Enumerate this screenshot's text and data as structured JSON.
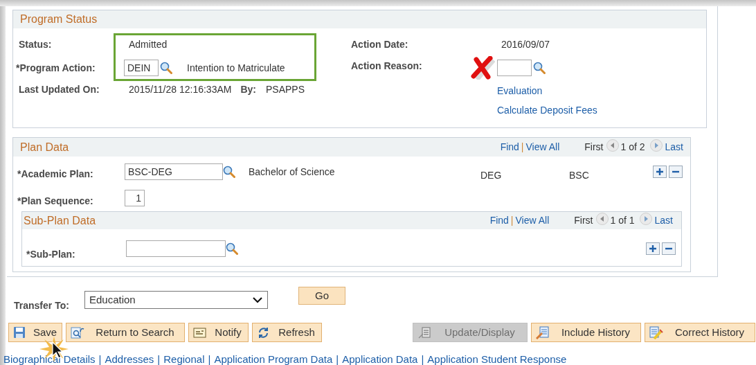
{
  "program_status": {
    "title": "Program Status",
    "status": {
      "label": "Status:",
      "value": "Admitted"
    },
    "program_action": {
      "label": "*Program Action:",
      "value": "DEIN",
      "description": "Intention to Matriculate"
    },
    "last_updated": {
      "label": "Last Updated On:",
      "value": "2015/11/28 12:16:33AM",
      "by_label": "By:",
      "by_value": "PSAPPS"
    },
    "action_date": {
      "label": "Action Date:",
      "value": "2016/09/07"
    },
    "action_reason": {
      "label": "Action Reason:"
    },
    "links": [
      "Evaluation",
      "Calculate Deposit Fees"
    ]
  },
  "plan_data": {
    "title": "Plan Data",
    "nav": {
      "find": "Find",
      "separator": "|",
      "view_all": "View All",
      "first": "First",
      "count": "1 of 2",
      "last": "Last"
    },
    "academic_plan": {
      "label": "*Academic Plan:",
      "value": "BSC-DEG",
      "description": "Bachelor of Science",
      "column_4": "DEG",
      "column_5": "BSC"
    },
    "plan_sequence": {
      "label": "*Plan Sequence:",
      "value": "1"
    },
    "sub_plan_data": {
      "title": "Sub-Plan Data",
      "nav": {
        "find": "Find",
        "separator": "|",
        "view_all": "View All",
        "first": "First",
        "count": "1 of 1",
        "last": "Last"
      },
      "sub_plan": {
        "label": "*Sub-Plan:"
      }
    }
  },
  "transfer": {
    "label": "Transfer To:",
    "value": "Education",
    "go": "Go"
  },
  "buttons": [
    {
      "label": "Save",
      "kind": "save",
      "disabled": false
    },
    {
      "label": "Return to Search",
      "kind": "return",
      "disabled": false
    },
    {
      "label": "Notify",
      "kind": "notify",
      "disabled": false
    },
    {
      "label": "Refresh",
      "kind": "refresh",
      "disabled": false
    },
    {
      "label": "Update/Display",
      "kind": "update",
      "disabled": true
    },
    {
      "label": "Include History",
      "kind": "include",
      "disabled": false
    },
    {
      "label": "Correct History",
      "kind": "correct",
      "disabled": false
    }
  ],
  "links": {
    "separator": "|",
    "items": [
      "Biographical Details",
      "Addresses",
      "Regional",
      "Application Program Data",
      "Application Data",
      "Application Student Response"
    ]
  }
}
